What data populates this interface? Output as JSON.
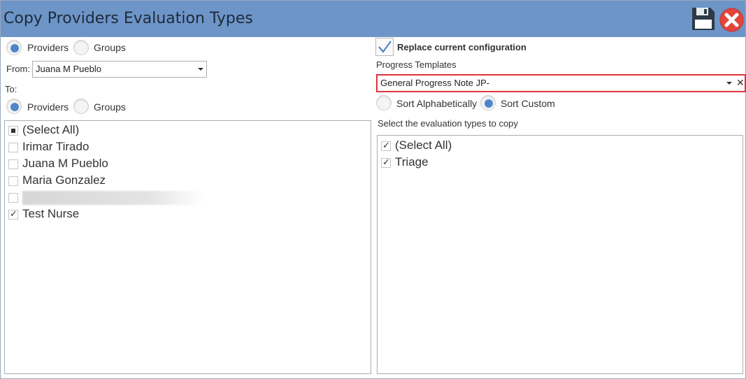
{
  "window": {
    "title": "Copy Providers Evaluation Types",
    "accent_color": "#6d95c8",
    "save_icon": "floppy-disk-icon",
    "close_icon": "red-x-circle-icon"
  },
  "left": {
    "source_mode": {
      "providers_label": "Providers",
      "groups_label": "Groups",
      "selected": "Providers"
    },
    "from_label": "From:",
    "from_value": "Juana M Pueblo",
    "to_label": "To:",
    "target_mode": {
      "providers_label": "Providers",
      "groups_label": "Groups",
      "selected": "Providers"
    },
    "targets": [
      {
        "label": "(Select All)",
        "state": "indeterminate"
      },
      {
        "label": "Irimar Tirado",
        "state": "unchecked"
      },
      {
        "label": "Juana M Pueblo",
        "state": "unchecked"
      },
      {
        "label": "Maria Gonzalez",
        "state": "unchecked"
      },
      {
        "label": "",
        "state": "unchecked",
        "redacted": true
      },
      {
        "label": "Test Nurse",
        "state": "checked"
      }
    ]
  },
  "right": {
    "replace_label": "Replace current configuration",
    "replace_checked": true,
    "templates_label": "Progress Templates",
    "template_value": "General Progress Note JP-",
    "highlight_color": "#e0343c",
    "sort": {
      "alpha_label": "Sort Alphabetically",
      "custom_label": "Sort Custom",
      "selected": "Sort Custom"
    },
    "eval_caption": "Select the evaluation types to copy",
    "eval_types": [
      {
        "label": "(Select All)",
        "state": "checked"
      },
      {
        "label": "Triage",
        "state": "checked"
      }
    ]
  }
}
